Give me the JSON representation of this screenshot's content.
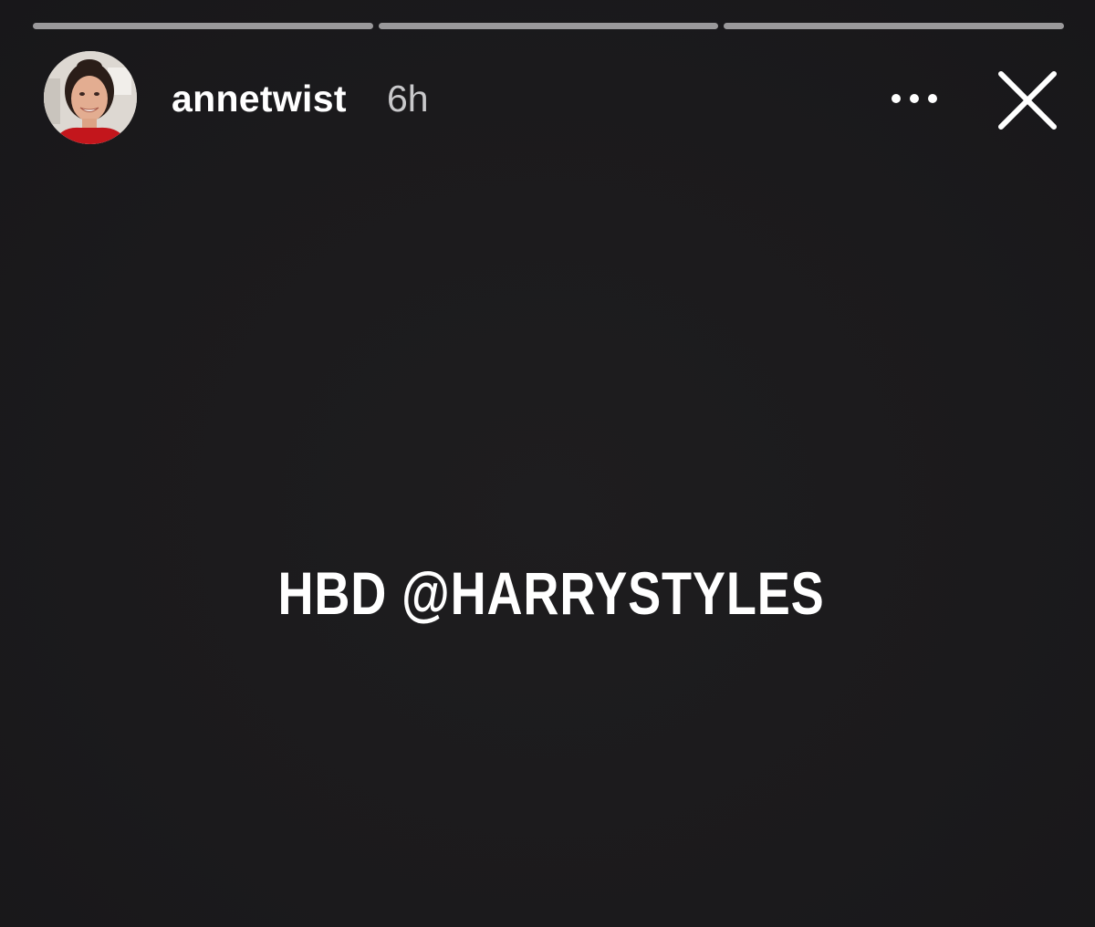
{
  "story": {
    "progress": [
      1,
      1,
      1
    ],
    "username": "annetwist",
    "timestamp": "6h",
    "caption": "HBD @HARRYSTYLES"
  },
  "icons": {
    "avatar": "profile-photo",
    "more": "more-horizontal-icon",
    "close": "close-icon"
  },
  "colors": {
    "background": "#1c1b1d",
    "text": "#ffffff",
    "muted_text": "#c9c9cb",
    "progress": "#9a999b"
  }
}
